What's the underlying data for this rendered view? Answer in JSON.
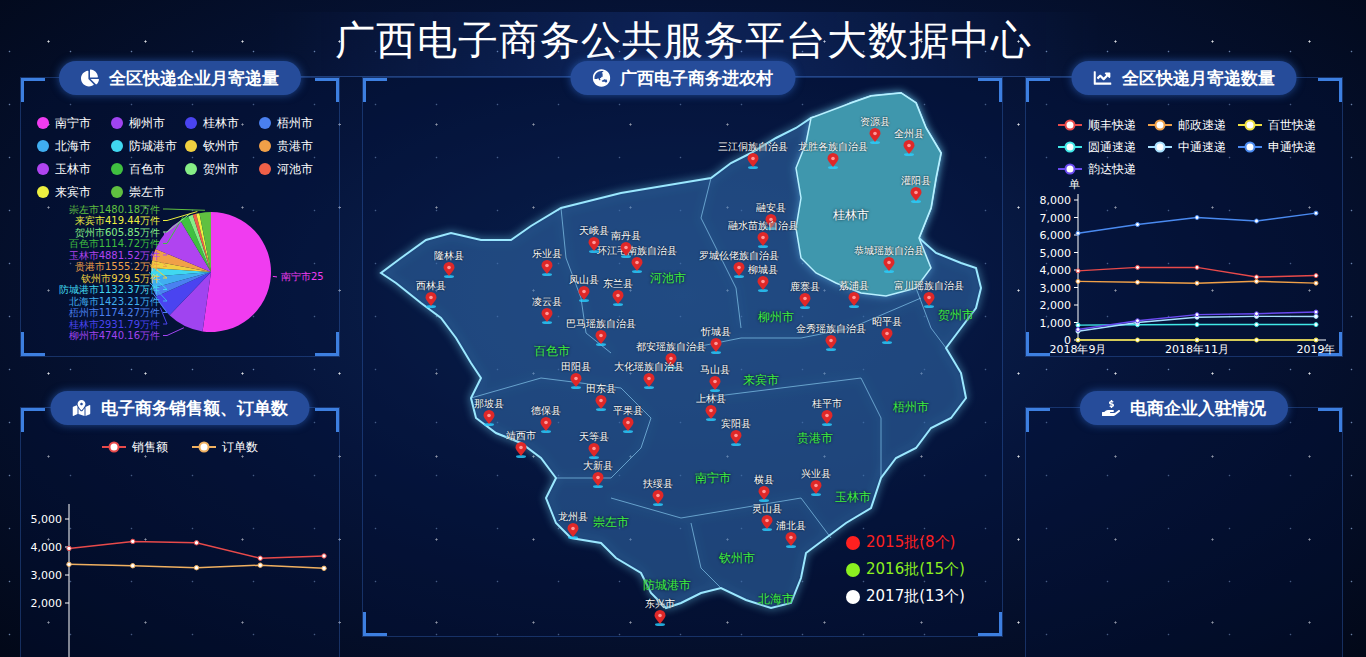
{
  "title": "广西电子商务公共服务平台大数据中心",
  "express_panel": {
    "title": "全区快递企业月寄递量",
    "slices": [
      {
        "name": "南宁市",
        "label": "南宁市25",
        "value": 25000,
        "color": "#f03cf0"
      },
      {
        "name": "柳州市",
        "label": "柳州市4740.16万件",
        "value": 4740.16,
        "color": "#a044f0"
      },
      {
        "name": "桂林市",
        "label": "桂林市2931.79万件",
        "value": 2931.79,
        "color": "#4a44f0"
      },
      {
        "name": "梧州市",
        "label": "梧州市1174.27万件",
        "value": 1174.27,
        "color": "#4a80f0"
      },
      {
        "name": "北海市",
        "label": "北海市1423.21万件",
        "value": 1423.21,
        "color": "#40aef0"
      },
      {
        "name": "防城港市",
        "label": "防城港市1132.37万件",
        "value": 1132.37,
        "color": "#40d8f0"
      },
      {
        "name": "钦州市",
        "label": "钦州市929.5万件",
        "value": 929.5,
        "color": "#f0d040"
      },
      {
        "name": "贵港市",
        "label": "贵港市1555.2万件",
        "value": 1555.2,
        "color": "#f0a048"
      },
      {
        "name": "玉林市",
        "label": "玉林市4881.52万件",
        "value": 4881.52,
        "color": "#b044f0"
      },
      {
        "name": "百色市",
        "label": "百色市1114.72万件",
        "value": 1114.72,
        "color": "#40c040"
      },
      {
        "name": "贺州市",
        "label": "贺州市605.85万件",
        "value": 605.85,
        "color": "#86ee86"
      },
      {
        "name": "河池市",
        "value": 459.2,
        "color": "#f06048"
      },
      {
        "name": "来宾市",
        "label": "来宾市419.44万件",
        "value": 419.44,
        "color": "#eef040"
      },
      {
        "name": "崇左市",
        "label": "崇左市1480.18万件",
        "value": 1480.18,
        "color": "#60c040"
      }
    ]
  },
  "sales_panel": {
    "title": "电子商务销售额、订单数",
    "axis_ticks": [
      "5,000",
      "4,000",
      "3,000",
      "2,000"
    ],
    "series": [
      {
        "name": "销售额",
        "color": "#e84a4a",
        "values": [
          3950,
          4200,
          4150,
          3600,
          3680
        ]
      },
      {
        "name": "订单数",
        "color": "#f0b060",
        "values": [
          3380,
          3330,
          3260,
          3350,
          3240
        ]
      }
    ]
  },
  "map_panel": {
    "title": "广西电子商务进农村",
    "cities": [
      {
        "name": "桂林市",
        "highlighted": true
      },
      {
        "name": "河池市",
        "highlighted": false
      },
      {
        "name": "柳州市",
        "highlighted": false
      },
      {
        "name": "贺州市",
        "highlighted": false
      },
      {
        "name": "百色市",
        "highlighted": false
      },
      {
        "name": "来宾市",
        "highlighted": false
      },
      {
        "name": "梧州市",
        "highlighted": false
      },
      {
        "name": "贵港市",
        "highlighted": false
      },
      {
        "name": "南宁市",
        "highlighted": false
      },
      {
        "name": "玉林市",
        "highlighted": false
      },
      {
        "name": "崇左市",
        "highlighted": false
      },
      {
        "name": "钦州市",
        "highlighted": false
      },
      {
        "name": "防城港市",
        "highlighted": false
      },
      {
        "name": "北海市",
        "highlighted": false
      }
    ],
    "counties": [
      "资源县",
      "全州县",
      "三江侗族自治县",
      "龙胜各族自治县",
      "灌阳县",
      "融安县",
      "融水苗族自治县",
      "恭城瑶族自治县",
      "环江毛南族自治县",
      "罗城仫佬族自治县",
      "柳城县",
      "鹿寨县",
      "荔浦县",
      "富川瑶族自治县",
      "金秀瑶族自治县",
      "昭平县",
      "忻城县",
      "巴马瑶族自治县",
      "凤山县",
      "东兰县",
      "天峨县",
      "南丹县",
      "乐业县",
      "凌云县",
      "隆林县",
      "西林县",
      "都安瑶族自治县",
      "大化瑶族自治县",
      "马山县",
      "田阳县",
      "田东县",
      "德保县",
      "靖西市",
      "那坡县",
      "天等县",
      "大新县",
      "平果县",
      "上林县",
      "宾阳县",
      "扶绥县",
      "横县",
      "兴业县",
      "桂平市",
      "龙州县",
      "灵山县",
      "浦北县",
      "东兴市"
    ],
    "batches": [
      {
        "label": "2015批(8个)",
        "color": "#ff2020"
      },
      {
        "label": "2016批(15个)",
        "color": "#8cf020"
      },
      {
        "label": "2017批(13个)",
        "color": "#ffffff"
      }
    ]
  },
  "courier_panel": {
    "title": "全区快递月寄递数量",
    "unit": "单",
    "axis_ticks": [
      "8,000",
      "7,000",
      "6,000",
      "5,000",
      "4,000",
      "3,000",
      "2,000",
      "1,000",
      "0"
    ],
    "x_labels": [
      "2018年9月",
      "2018年11月",
      "2019年"
    ],
    "series": [
      {
        "name": "顺丰快递",
        "color": "#e84a4a",
        "values": [
          3950,
          4150,
          4150,
          3600,
          3680
        ]
      },
      {
        "name": "邮政速递",
        "color": "#f0a048",
        "values": [
          3350,
          3300,
          3250,
          3350,
          3250
        ]
      },
      {
        "name": "百世快递",
        "color": "#f0e040",
        "values": [
          0,
          0,
          0,
          0,
          0
        ]
      },
      {
        "name": "圆通速递",
        "color": "#40e8e8",
        "values": [
          850,
          870,
          880,
          880,
          880
        ]
      },
      {
        "name": "中通速递",
        "color": "#a8e0ff",
        "values": [
          500,
          1000,
          1300,
          1350,
          1350
        ]
      },
      {
        "name": "申通快递",
        "color": "#4a8af0",
        "values": [
          6100,
          6600,
          7000,
          6800,
          7250
        ]
      },
      {
        "name": "韵达快递",
        "color": "#6a4af0",
        "values": [
          600,
          1100,
          1450,
          1500,
          1600
        ]
      }
    ]
  },
  "enterprise_panel": {
    "title": "电商企业入驻情况"
  }
}
